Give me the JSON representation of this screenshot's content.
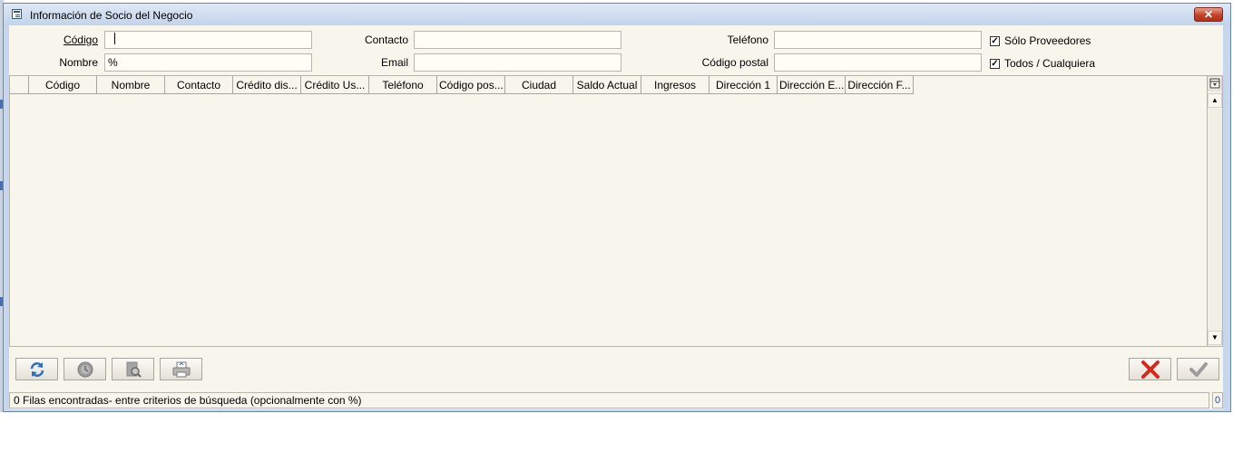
{
  "window": {
    "title": "Información de Socio del Negocio",
    "close_icon": "close-icon"
  },
  "search": {
    "codigo_label": "Código",
    "codigo_value": "",
    "nombre_label": "Nombre",
    "nombre_value": "%",
    "contacto_label": "Contacto",
    "contacto_value": "",
    "email_label": "Email",
    "email_value": "",
    "telefono_label": "Teléfono",
    "telefono_value": "",
    "codigo_postal_label": "Código postal",
    "codigo_postal_value": "",
    "solo_proveedores_label": "Sólo Proveedores",
    "solo_proveedores_checked": true,
    "todos_label": "Todos / Cualquiera",
    "todos_checked": true
  },
  "grid": {
    "columns": [
      "Código",
      "Nombre",
      "Contacto",
      "Crédito dis...",
      "Crédito Us...",
      "Teléfono",
      "Código pos...",
      "Ciudad",
      "Saldo Actual",
      "Ingresos",
      "Dirección 1",
      "Dirección E...",
      "Dirección F..."
    ],
    "rows": []
  },
  "toolbar": {
    "icons": [
      "refresh-icon",
      "history-icon",
      "zoom-icon",
      "print-icon",
      "cancel-icon",
      "ok-icon"
    ]
  },
  "status": {
    "message": "0 Filas encontradas- entre criterios de búsqueda (opcionalmente con %)",
    "count": "0"
  },
  "colors": {
    "accent": "#c7d6ea",
    "background": "#f8f5ec",
    "close": "#c2422a",
    "refresh": "#2f6fbf"
  }
}
